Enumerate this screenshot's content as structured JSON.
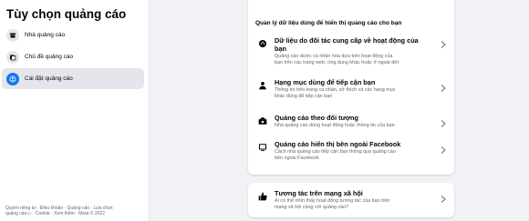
{
  "sidebar": {
    "title": "Tùy chọn quảng cáo",
    "items": [
      {
        "label": "Nhà quảng cáo",
        "icon": "storefront-icon",
        "active": false
      },
      {
        "label": "Chủ đề quảng cáo",
        "icon": "topics-icon",
        "active": false
      },
      {
        "label": "Cài đặt quảng cáo",
        "icon": "settings-person-icon",
        "active": true
      }
    ],
    "footer_line1": "Quyền riêng tư · Điều khoản · Quảng cáo · Lựa chọn",
    "footer_line2": "quảng cáo ▷ · Cookie · Xem thêm · Meta © 2022"
  },
  "main": {
    "section_header": "Quản lý dữ liệu dùng để hiển thị quảng cáo cho bạn",
    "rows": [
      {
        "icon": "data-partners-icon",
        "title_line1": "Dữ liệu do đối tác cung cấp về hoạt động của",
        "title_line2": "bạn",
        "desc_line1": "Quảng cáo được cá nhân hóa dựa trên hoạt động của",
        "desc_line2": "bạn trên các trang web, ứng dụng khác hoặc ở ngoài đời"
      },
      {
        "icon": "person-category-icon",
        "title_line1": "Hạng mục dùng để tiếp cận bạn",
        "desc_line1": "Thông tin trên trang cá nhân, sở thích và các hạng mục",
        "desc_line2": "khác dùng để tiếp cận bạn"
      },
      {
        "icon": "audience-icon",
        "title_line1": "Quảng cáo theo đối tượng",
        "desc_line1": "Nhà quảng cáo dùng hoạt động hoặc thông tin của bạn"
      },
      {
        "icon": "screen-icon",
        "title_line1": "Quảng cáo hiển thị bên ngoài Facebook",
        "desc_line1": "Cách nhà quảng cáo tiếp cận bạn thông qua quảng cáo",
        "desc_line2": "bên ngoài Facebook"
      }
    ],
    "social": {
      "icon": "thumbs-up-icon",
      "title": "Tương tác trên mạng xã hội",
      "desc_line1": "Ai có thể nhìn thấy hoạt động tương tác của bạn trên",
      "desc_line2": "mạng xã hội cùng với quảng cáo?"
    }
  },
  "colors": {
    "accent": "#1877f2",
    "secondary_text": "#65676b",
    "background": "#f0f2f5"
  }
}
